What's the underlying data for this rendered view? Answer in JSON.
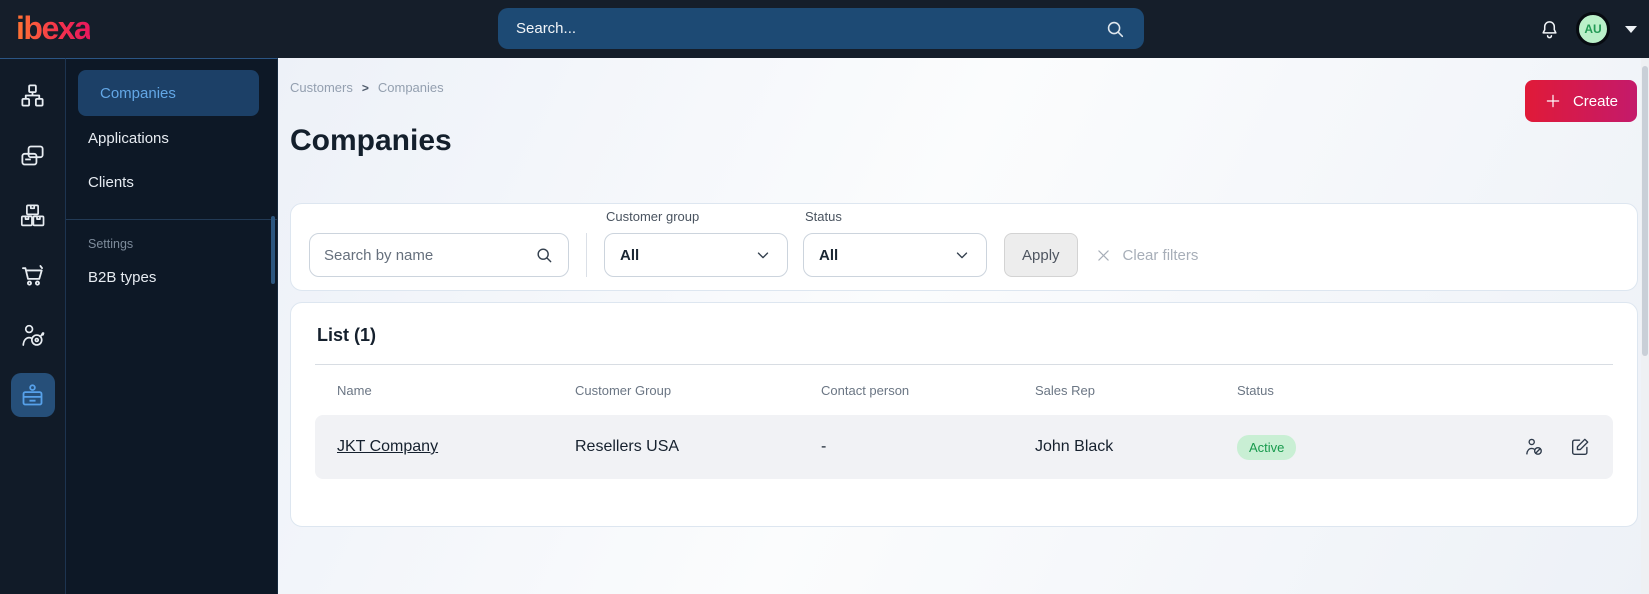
{
  "topbar": {
    "logo_text": "ibexa",
    "search_placeholder": "Search...",
    "avatar_initials": "AU"
  },
  "sidebar": {
    "items": [
      {
        "label": "Companies",
        "active": true
      },
      {
        "label": "Applications",
        "active": false
      },
      {
        "label": "Clients",
        "active": false
      }
    ],
    "settings_section_label": "Settings",
    "settings_items": [
      {
        "label": "B2B types"
      }
    ]
  },
  "rail_icons": [
    "org-chart-icon",
    "pages-icon",
    "boxes-icon",
    "cart-icon",
    "target-user-icon",
    "id-badge-icon"
  ],
  "header": {
    "breadcrumb": {
      "parent": "Customers",
      "separator": ">",
      "current": "Companies"
    },
    "title": "Companies",
    "create_label": "Create"
  },
  "filters": {
    "name_search_placeholder": "Search by name",
    "customer_group": {
      "label": "Customer group",
      "value": "All"
    },
    "status": {
      "label": "Status",
      "value": "All"
    },
    "apply_label": "Apply",
    "clear_label": "Clear filters"
  },
  "list": {
    "title": "List (1)",
    "columns": [
      "Name",
      "Customer Group",
      "Contact person",
      "Sales Rep",
      "Status"
    ],
    "rows": [
      {
        "name": "JKT Company",
        "customer_group": "Resellers USA",
        "contact_person": "-",
        "sales_rep": "John Black",
        "status": "Active"
      }
    ]
  },
  "colors": {
    "brand_red": "#e01a38",
    "brand_pink": "#c41a6b",
    "topbar_bg": "#151e2a",
    "search_bar_bg": "#1d4a74",
    "sidebar_active_bg": "#1c4067",
    "sidebar_active_text": "#63a7e6",
    "badge_active_bg": "#c9efd4",
    "badge_active_text": "#189a4d",
    "avatar_bg": "#baf0c9",
    "avatar_text": "#239a55"
  }
}
